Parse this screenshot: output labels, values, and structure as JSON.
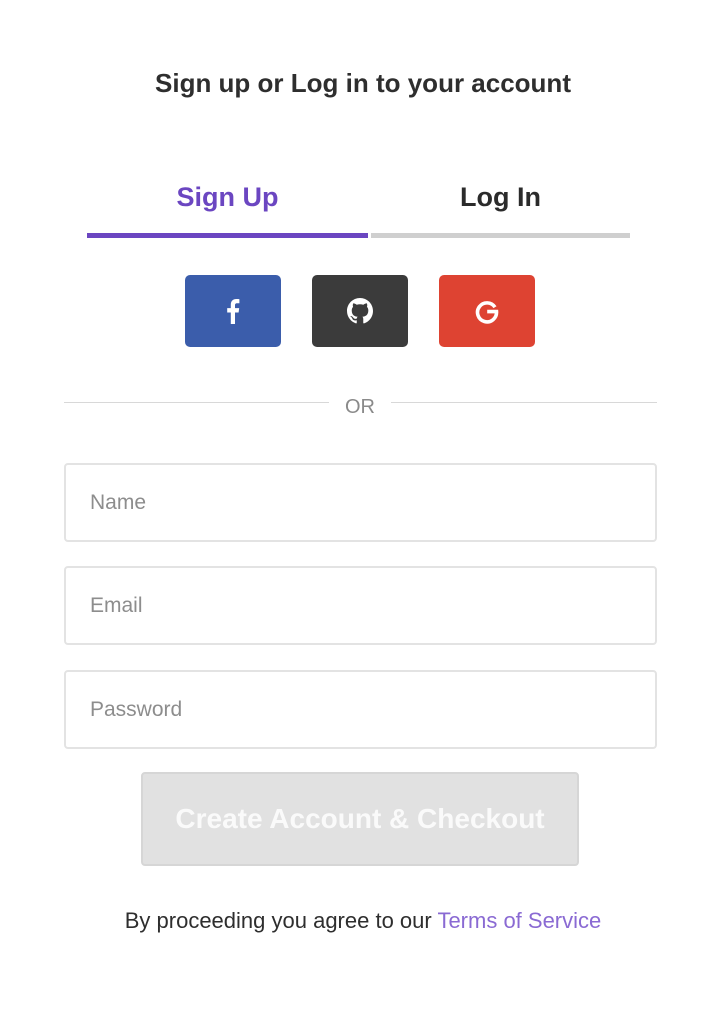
{
  "header": {
    "title": "Sign up or Log in to your account"
  },
  "tabs": [
    {
      "label": "Sign Up",
      "active": true
    },
    {
      "label": "Log In",
      "active": false
    }
  ],
  "social": [
    {
      "provider": "facebook",
      "icon": "facebook-icon",
      "color": "#3b5dab"
    },
    {
      "provider": "github",
      "icon": "github-icon",
      "color": "#3b3b3b"
    },
    {
      "provider": "google",
      "icon": "google-icon",
      "color": "#de4332"
    }
  ],
  "divider": {
    "text": "OR"
  },
  "form": {
    "name": {
      "placeholder": "Name",
      "value": ""
    },
    "email": {
      "placeholder": "Email",
      "value": ""
    },
    "password": {
      "placeholder": "Password",
      "value": ""
    },
    "submit_label": "Create Account & Checkout"
  },
  "footer": {
    "text": "By proceeding you agree to our ",
    "link": "Terms of Service"
  },
  "colors": {
    "accent": "#6b46c1",
    "link": "#8a6ad3",
    "disabled_button": "#e1e1e1"
  }
}
